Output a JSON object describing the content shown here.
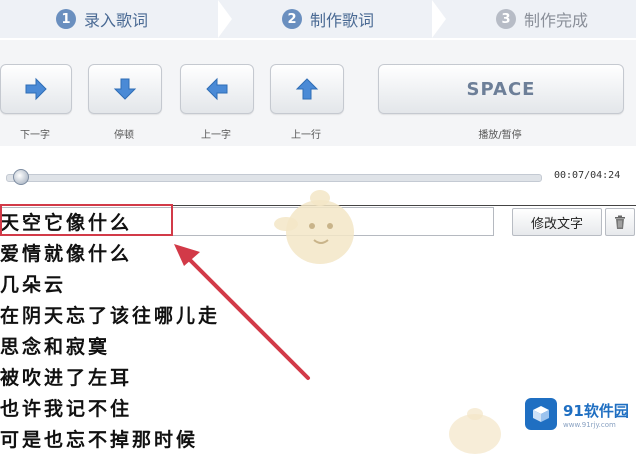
{
  "steps": [
    {
      "num": "1",
      "label": "录入歌词",
      "state": "done"
    },
    {
      "num": "2",
      "label": "制作歌词",
      "state": "active"
    },
    {
      "num": "3",
      "label": "制作完成",
      "state": "inactive"
    }
  ],
  "controls": {
    "next_char_label": "下一字",
    "pause_label": "停顿",
    "prev_char_label": "上一字",
    "prev_line_label": "上一行",
    "space_key": "SPACE",
    "play_pause_label": "播放/暂停"
  },
  "progress": {
    "time": "00:07/04:24",
    "fraction": 0.027
  },
  "editor": {
    "edit_text_button": "修改文字"
  },
  "lyrics": [
    "天空它像什么",
    "爱情就像什么",
    "几朵云",
    "在阴天忘了该往哪儿走",
    "思念和寂寞",
    "被吹进了左耳",
    "也许我记不住",
    "可是也忘不掉那时候"
  ],
  "watermark": {
    "brand_name": "91软件园",
    "brand_url": "www.91rjy.com"
  },
  "colors": {
    "accent": "#6a8fbf",
    "highlight": "#d23a48",
    "arrow_icon": "#4a8ad6"
  }
}
